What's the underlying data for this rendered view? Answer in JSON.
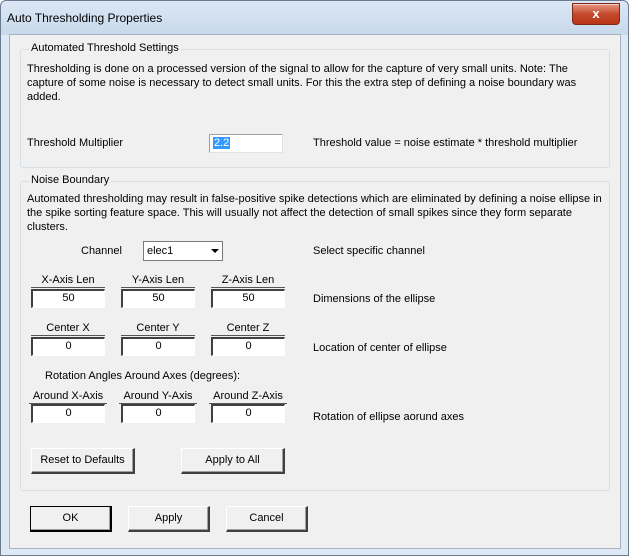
{
  "window": {
    "title": "Auto Thresholding Properties",
    "close_glyph": "x"
  },
  "auto": {
    "group_title": "Automated Threshold Settings",
    "description": "Thresholding is done on a processed version of the signal to allow for the capture of very small units. Note: The capture of some noise is necessary to detect small units.  For this the extra step of defining a noise boundary was added.",
    "multiplier_label": "Threshold Multiplier",
    "multiplier_value": "2.2",
    "formula_text": "Threshold value = noise estimate * threshold multiplier"
  },
  "noise": {
    "group_title": "Noise Boundary",
    "description": "Automated thresholding may result in false-positive spike detections which are eliminated by defining a noise ellipse in the spike sorting feature space.  This will usually not affect the detection of small spikes since they form separate clusters.",
    "channel_label": "Channel",
    "channel_value": "elec1",
    "channel_desc": "Select specific channel",
    "axis_len_labels": [
      "X-Axis Len",
      "Y-Axis Len",
      "Z-Axis Len"
    ],
    "axis_len_values": [
      "50",
      "50",
      "50"
    ],
    "axis_len_desc": "Dimensions of the ellipse",
    "center_labels": [
      "Center X",
      "Center Y",
      "Center Z"
    ],
    "center_values": [
      "0",
      "0",
      "0"
    ],
    "center_desc": "Location of center of ellipse",
    "rotation_title": "Rotation Angles Around Axes (degrees):",
    "rotation_labels": [
      "Around X-Axis",
      "Around Y-Axis",
      "Around Z-Axis"
    ],
    "rotation_values": [
      "0",
      "0",
      "0"
    ],
    "rotation_desc": "Rotation of ellipse aorund axes",
    "reset_label": "Reset to Defaults",
    "apply_all_label": "Apply to All"
  },
  "footer": {
    "ok_label": "OK",
    "apply_label": "Apply",
    "cancel_label": "Cancel"
  }
}
